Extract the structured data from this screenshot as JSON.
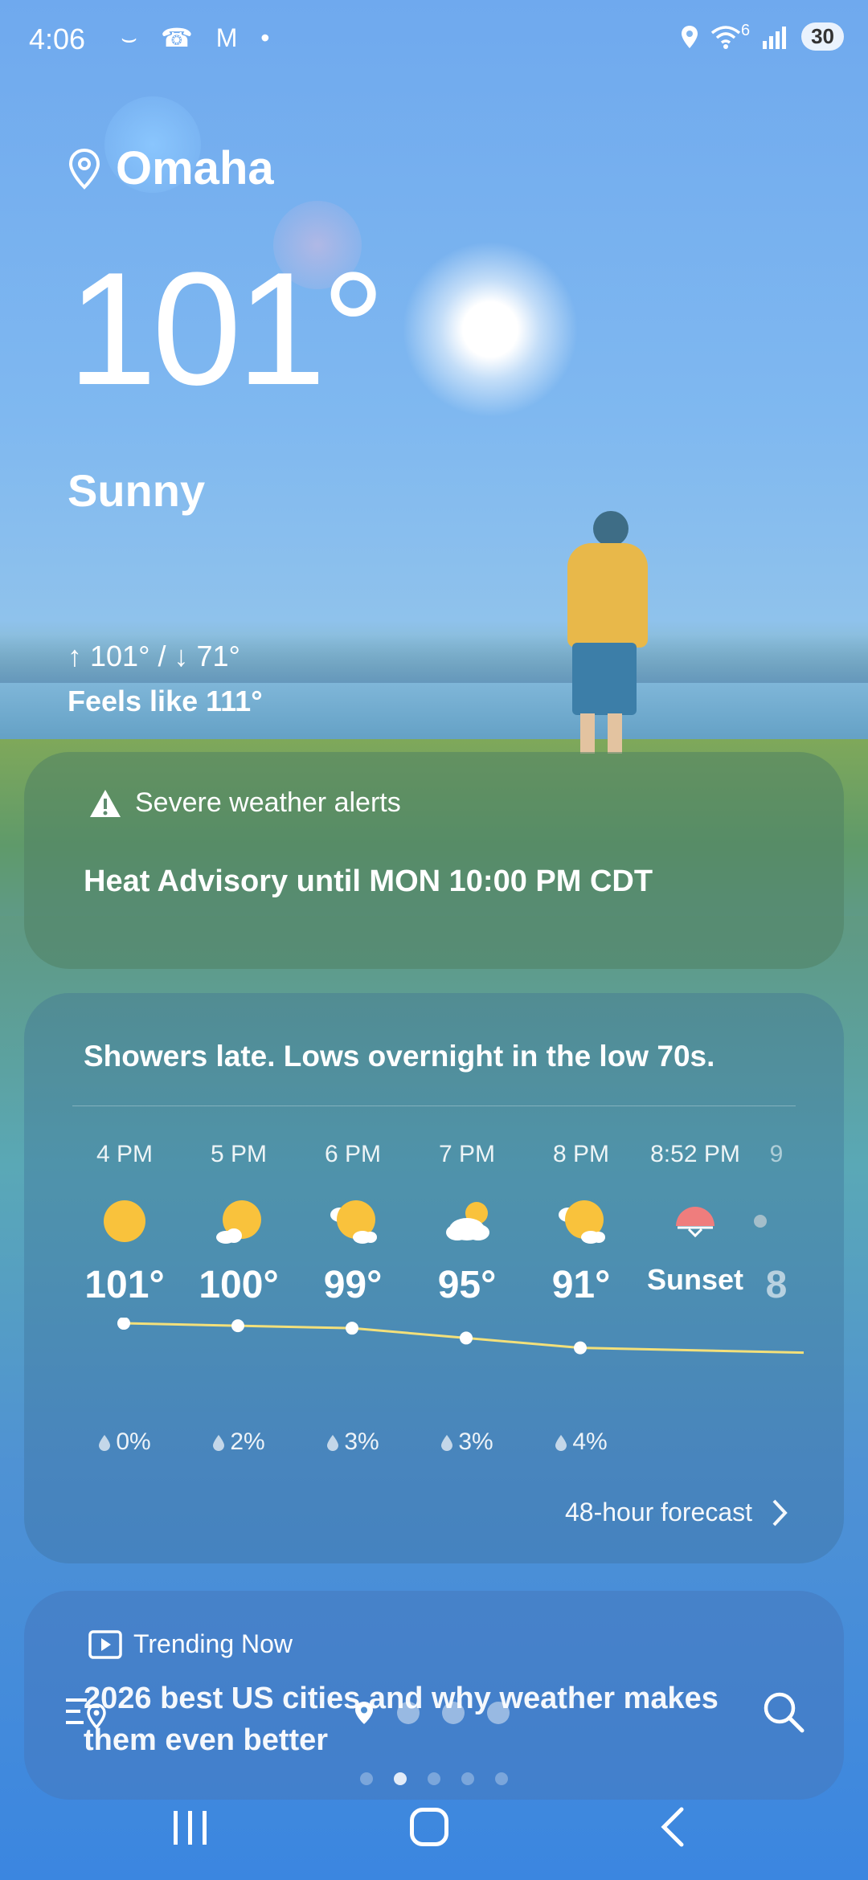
{
  "status_bar": {
    "time": "4:06",
    "left_icons": "⌣ ☎ M •",
    "signal_label": "6",
    "battery": "30"
  },
  "location": {
    "city": "Omaha",
    "icon": "location-pin-icon"
  },
  "current": {
    "temperature": "101°",
    "condition": "Sunny",
    "high_low": "↑ 101° / ↓ 71°",
    "feels_like": "Feels like 111°"
  },
  "alert": {
    "header": "Severe weather alerts",
    "text": "Heat Advisory until MON 10:00 PM CDT"
  },
  "forecast": {
    "summary": "Showers late. Lows overnight in the low 70s.",
    "hours": [
      {
        "time": "4 PM",
        "icon": "sun-icon",
        "temp": "101°",
        "rain": "0%",
        "value": 101
      },
      {
        "time": "5 PM",
        "icon": "sun-cloud-icon",
        "temp": "100°",
        "rain": "2%",
        "value": 100
      },
      {
        "time": "6 PM",
        "icon": "partly-cloudy-icon",
        "temp": "99°",
        "rain": "3%",
        "value": 99
      },
      {
        "time": "7 PM",
        "icon": "mostly-cloudy-icon",
        "temp": "95°",
        "rain": "3%",
        "value": 95
      },
      {
        "time": "8 PM",
        "icon": "partly-cloudy-icon",
        "temp": "91°",
        "rain": "4%",
        "value": 91
      },
      {
        "time": "8:52 PM",
        "icon": "sunset-icon",
        "temp": "Sunset",
        "rain": "",
        "value": null
      },
      {
        "time": "9",
        "icon": "moon-icon",
        "temp": "8",
        "rain": "",
        "value": null
      }
    ],
    "link": "48-hour forecast"
  },
  "trending": {
    "header": "Trending Now",
    "text": "2026 best US cities and why weather makes them even better"
  },
  "colors": {
    "sun_yellow": "#f9c23c",
    "sunset_red": "#ef7d7d",
    "temp_line": "#f3e07a"
  }
}
